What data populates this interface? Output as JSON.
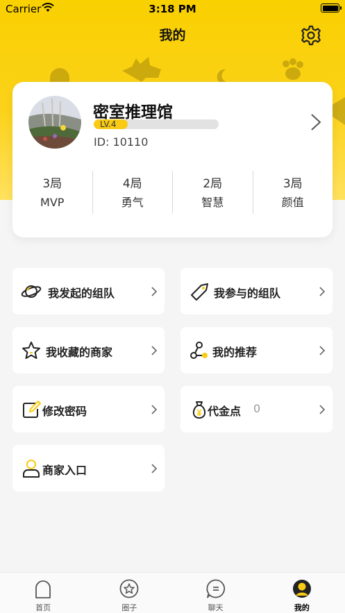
{
  "status_bar": {
    "carrier": "Carrier",
    "time": "3:18 PM"
  },
  "header": {
    "title": "我的"
  },
  "profile": {
    "name": "密室推理馆",
    "level": "LV.4",
    "level_progress": 0.27,
    "id": "ID: 10110",
    "stats": [
      {
        "count": "3局",
        "label": "MVP"
      },
      {
        "count": "4局",
        "label": "勇气"
      },
      {
        "count": "2局",
        "label": "智慧"
      },
      {
        "count": "3局",
        "label": "颜值"
      }
    ]
  },
  "menu": {
    "my_started_teams": {
      "label": "我发起的组队",
      "icon": "planet-icon"
    },
    "my_joined_teams": {
      "label": "我参与的组队",
      "icon": "tag-icon"
    },
    "favorite_merchants": {
      "label": "我收藏的商家",
      "icon": "star-icon"
    },
    "my_referrals": {
      "label": "我的推荐",
      "icon": "share-nodes-icon"
    },
    "change_password": {
      "label": "修改密码",
      "icon": "edit-icon"
    },
    "voucher_points": {
      "label": "代金点",
      "value": "0",
      "icon": "money-bag-icon"
    },
    "merchant_entry": {
      "label": "商家入口",
      "icon": "user-icon"
    }
  },
  "tabs": [
    {
      "label": "首页",
      "icon": "ghost-icon"
    },
    {
      "label": "圈子",
      "icon": "star-circle-icon"
    },
    {
      "label": "聊天",
      "icon": "chat-icon"
    },
    {
      "label": "我的",
      "icon": "profile-icon",
      "active": true
    }
  ],
  "colors": {
    "accent": "#f9cb14",
    "header_yellow": "#fbd21a",
    "background": "#f5f5f5"
  }
}
